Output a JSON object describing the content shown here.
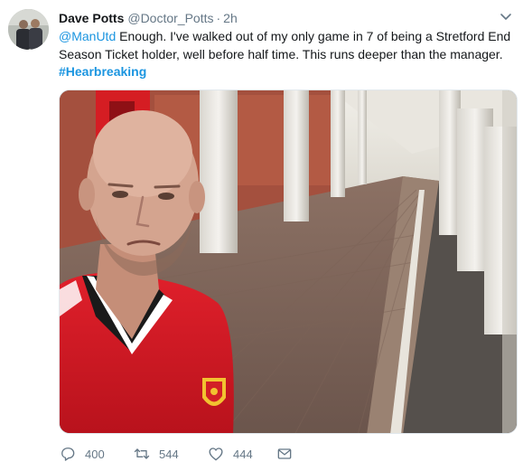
{
  "tweet": {
    "author_name": "Dave Potts",
    "author_handle": "@Doctor_Potts",
    "separator": "·",
    "time": "2h",
    "mention": "@ManUtd",
    "body": " Enough. I've walked out of my only game in 7 of being a Stretford End Season Ticket holder, well before half time. This runs deeper than the manager.",
    "hashtag": "#Hearbreaking"
  },
  "actions": {
    "replies": "400",
    "retweets": "544",
    "likes": "444"
  },
  "icons": [
    "chevron-down-icon",
    "reply-icon",
    "retweet-icon",
    "heart-icon",
    "envelope-icon"
  ],
  "colors": {
    "link": "#1b95e0",
    "secondary_text": "#657786",
    "primary_text": "#14171a"
  }
}
